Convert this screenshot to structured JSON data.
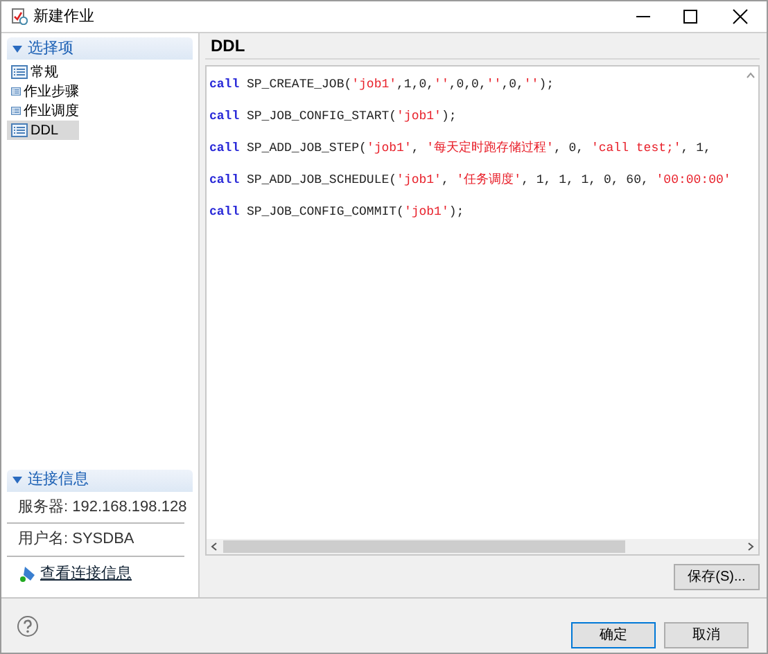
{
  "window": {
    "title": "新建作业"
  },
  "sidebar": {
    "header": "选择项",
    "expanded": true,
    "items": [
      {
        "label": "常规",
        "selected": false
      },
      {
        "label": "作业步骤",
        "selected": false
      },
      {
        "label": "作业调度",
        "selected": false
      },
      {
        "label": "DDL",
        "selected": true
      }
    ]
  },
  "connection": {
    "header": "连接信息",
    "expanded": true,
    "server": "服务器: 192.168.198.128",
    "user": "用户名: SYSDBA",
    "link": "查看连接信息"
  },
  "panel": {
    "title": "DDL"
  },
  "code_lines": [
    [
      {
        "kind": "keyword",
        "text": "call"
      },
      {
        "kind": "plain",
        "text": " SP_CREATE_JOB("
      },
      {
        "kind": "string",
        "text": "'job1'"
      },
      {
        "kind": "plain",
        "text": ",1,0,"
      },
      {
        "kind": "string",
        "text": "''"
      },
      {
        "kind": "plain",
        "text": ",0,0,"
      },
      {
        "kind": "string",
        "text": "''"
      },
      {
        "kind": "plain",
        "text": ",0,"
      },
      {
        "kind": "string",
        "text": "''"
      },
      {
        "kind": "plain",
        "text": ");"
      }
    ],
    [
      {
        "kind": "keyword",
        "text": "call"
      },
      {
        "kind": "plain",
        "text": " SP_JOB_CONFIG_START("
      },
      {
        "kind": "string",
        "text": "'job1'"
      },
      {
        "kind": "plain",
        "text": ");"
      }
    ],
    [
      {
        "kind": "keyword",
        "text": "call"
      },
      {
        "kind": "plain",
        "text": " SP_ADD_JOB_STEP("
      },
      {
        "kind": "string",
        "text": "'job1'"
      },
      {
        "kind": "plain",
        "text": ", "
      },
      {
        "kind": "string",
        "text": "'每天定时跑存储过程'"
      },
      {
        "kind": "plain",
        "text": ", 0, "
      },
      {
        "kind": "string",
        "text": "'call test;'"
      },
      {
        "kind": "plain",
        "text": ", 1,"
      }
    ],
    [
      {
        "kind": "keyword",
        "text": "call"
      },
      {
        "kind": "plain",
        "text": " SP_ADD_JOB_SCHEDULE("
      },
      {
        "kind": "string",
        "text": "'job1'"
      },
      {
        "kind": "plain",
        "text": ", "
      },
      {
        "kind": "string",
        "text": "'任务调度'"
      },
      {
        "kind": "plain",
        "text": ", 1, 1, 1, 0, 60, "
      },
      {
        "kind": "string",
        "text": "'00:00:00'"
      }
    ],
    [
      {
        "kind": "keyword",
        "text": "call"
      },
      {
        "kind": "plain",
        "text": " SP_JOB_CONFIG_COMMIT("
      },
      {
        "kind": "string",
        "text": "'job1'"
      },
      {
        "kind": "plain",
        "text": ");"
      }
    ]
  ],
  "save_button": "保存(S)...",
  "footer_buttons": [
    {
      "label": "确定",
      "kind": "default"
    },
    {
      "label": "取消",
      "kind": "normal"
    }
  ]
}
